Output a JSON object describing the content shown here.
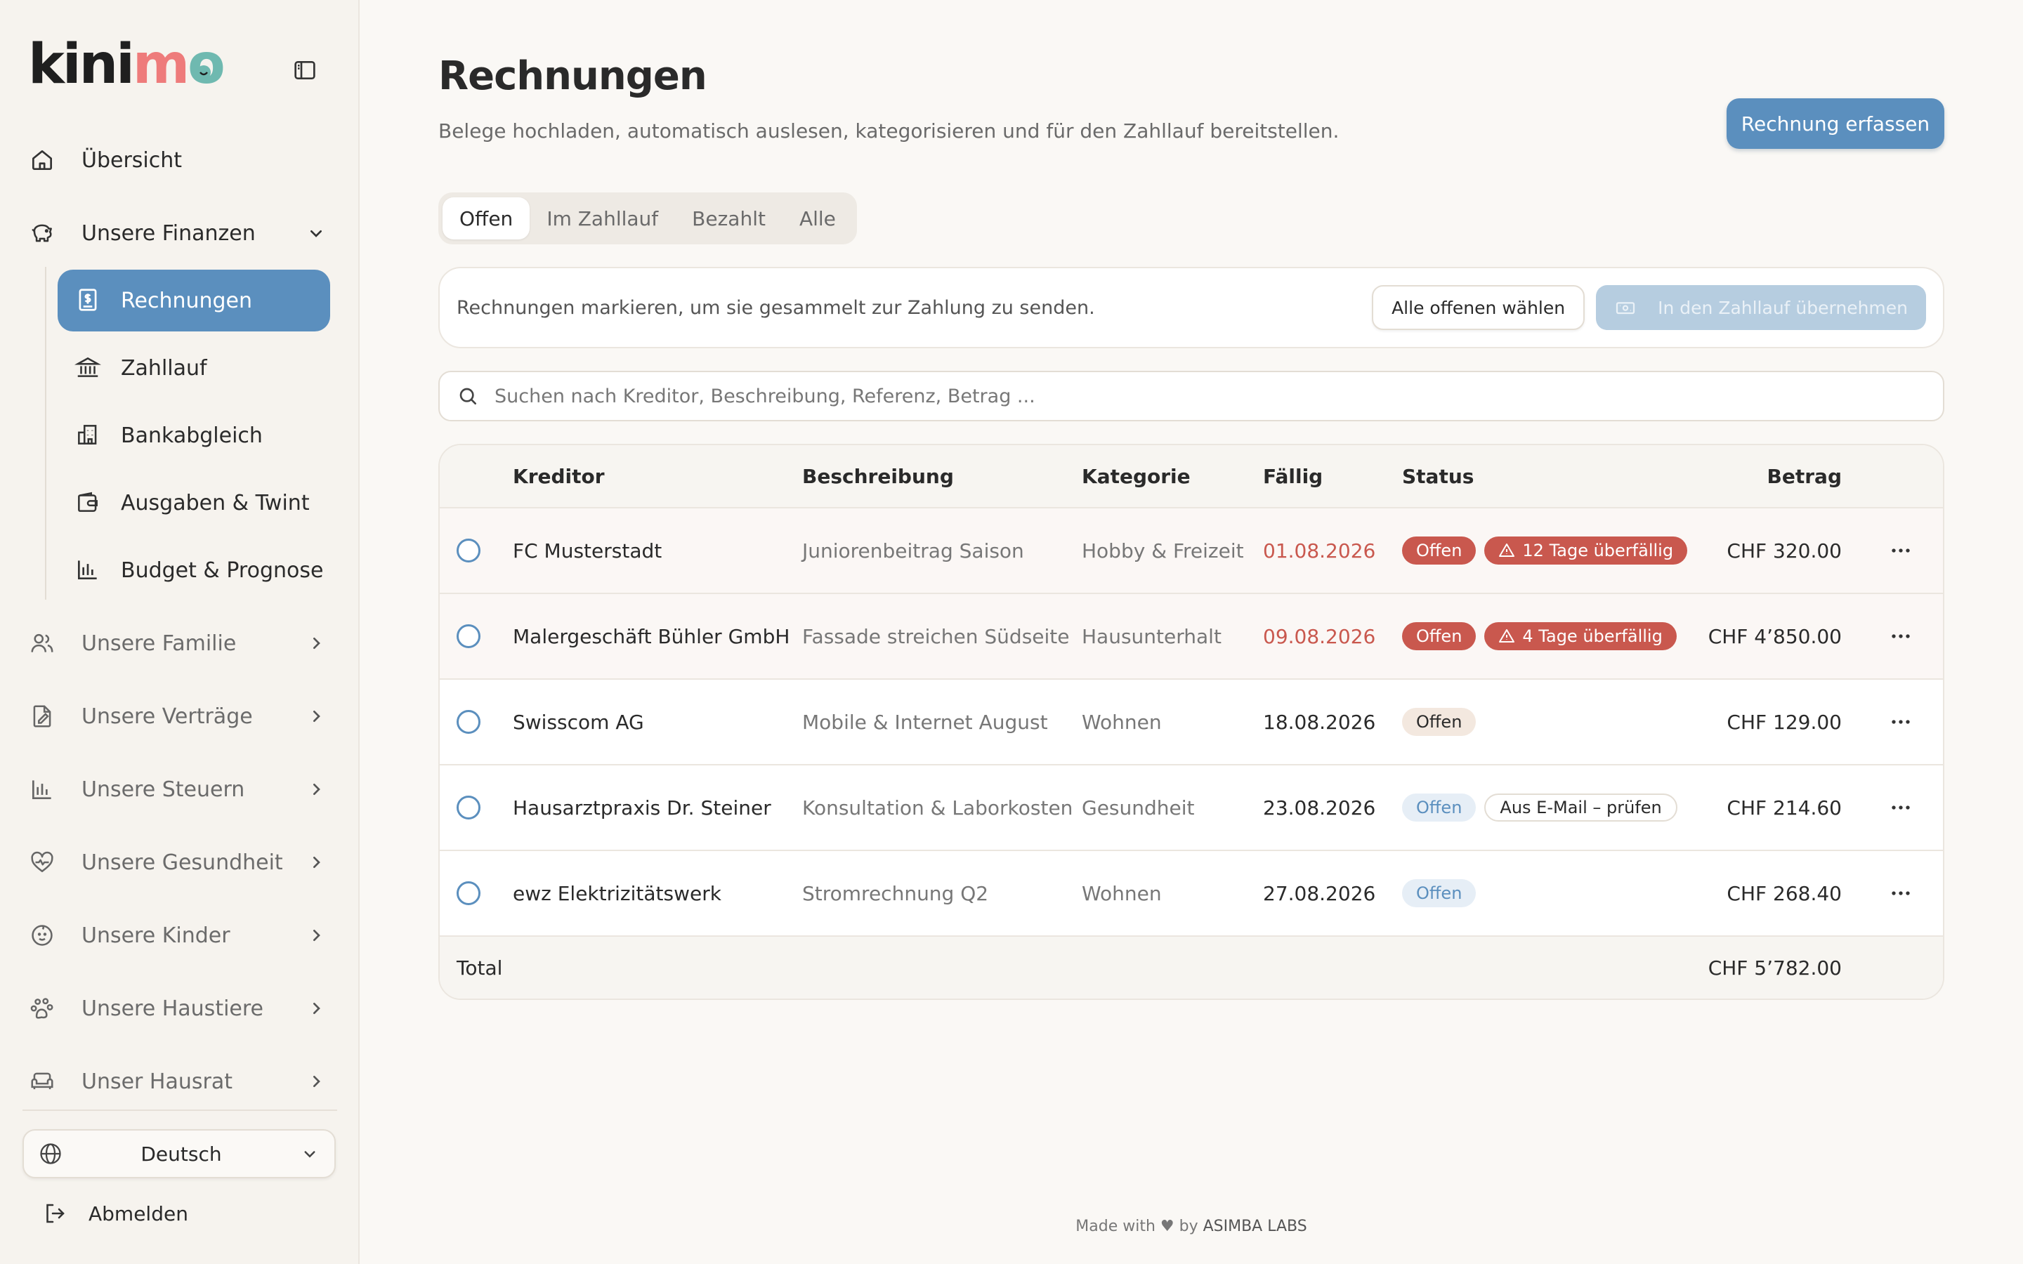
{
  "app": {
    "logo_text": "kinimo"
  },
  "sidebar": {
    "overview": "Übersicht",
    "finances": "Unsere Finanzen",
    "sub_items": [
      {
        "label": "Rechnungen",
        "icon": "invoice-icon",
        "active": true
      },
      {
        "label": "Zahllauf",
        "icon": "bank-icon",
        "active": false
      },
      {
        "label": "Bankabgleich",
        "icon": "building-icon",
        "active": false
      },
      {
        "label": "Ausgaben & Twint",
        "icon": "wallet-icon",
        "active": false
      },
      {
        "label": "Budget & Prognose",
        "icon": "chart-bars-icon",
        "active": false
      }
    ],
    "sections": [
      {
        "label": "Unsere Familie",
        "icon": "users-icon"
      },
      {
        "label": "Unsere Verträge",
        "icon": "contract-icon"
      },
      {
        "label": "Unsere Steuern",
        "icon": "chart-bars-icon"
      },
      {
        "label": "Unsere Gesundheit",
        "icon": "heart-pulse-icon"
      },
      {
        "label": "Unsere Kinder",
        "icon": "baby-icon"
      },
      {
        "label": "Unsere Haustiere",
        "icon": "paw-icon"
      },
      {
        "label": "Unser Hausrat",
        "icon": "sofa-icon"
      }
    ],
    "language": "Deutsch",
    "logout": "Abmelden"
  },
  "main": {
    "title": "Rechnungen",
    "subtitle": "Belege hochladen, automatisch auslesen, kategorisieren und für den Zahllauf bereitstellen.",
    "primary_button": "Rechnung erfassen",
    "tabs": [
      "Offen",
      "Im Zahllauf",
      "Bezahlt",
      "Alle"
    ],
    "active_tab": "Offen",
    "info_text": "Rechnungen markieren, um sie gesammelt zur Zahlung zu senden.",
    "select_all_button": "Alle offenen wählen",
    "transfer_button": "In den Zahllauf übernehmen",
    "search_placeholder": "Suchen nach Kreditor, Beschreibung, Referenz, Betrag ..."
  },
  "table": {
    "headers": {
      "kreditor": "Kreditor",
      "beschreibung": "Beschreibung",
      "kategorie": "Kategorie",
      "faellig": "Fällig",
      "status": "Status",
      "betrag": "Betrag"
    },
    "rows": [
      {
        "kreditor": "FC Musterstadt",
        "beschreibung": "Juniorenbeitrag Saison",
        "kategorie": "Hobby & Freizeit",
        "faellig": "01.08.2026",
        "overdue": true,
        "status": "Offen",
        "status_style": "red",
        "extra": "12 Tage überfällig",
        "extra_style": "red",
        "betrag": "CHF 320.00"
      },
      {
        "kreditor": "Malergeschäft Bühler GmbH",
        "beschreibung": "Fassade streichen Südseite",
        "kategorie": "Hausunterhalt",
        "faellig": "09.08.2026",
        "overdue": true,
        "status": "Offen",
        "status_style": "red",
        "extra": "4 Tage überfällig",
        "extra_style": "red",
        "betrag": "CHF 4’850.00"
      },
      {
        "kreditor": "Swisscom AG",
        "beschreibung": "Mobile & Internet August",
        "kategorie": "Wohnen",
        "faellig": "18.08.2026",
        "overdue": false,
        "status": "Offen",
        "status_style": "beige",
        "extra": "",
        "extra_style": "",
        "betrag": "CHF 129.00"
      },
      {
        "kreditor": "Hausarztpraxis Dr. Steiner",
        "beschreibung": "Konsultation & Laborkosten",
        "kategorie": "Gesundheit",
        "faellig": "23.08.2026",
        "overdue": false,
        "status": "Offen",
        "status_style": "blue",
        "extra": "Aus E-Mail – prüfen",
        "extra_style": "outline",
        "betrag": "CHF 214.60"
      },
      {
        "kreditor": "ewz Elektrizitätswerk",
        "beschreibung": "Stromrechnung Q2",
        "kategorie": "Wohnen",
        "faellig": "27.08.2026",
        "overdue": false,
        "status": "Offen",
        "status_style": "blue",
        "extra": "",
        "extra_style": "",
        "betrag": "CHF 268.40"
      }
    ],
    "total_label": "Total",
    "total_amount": "CHF 5’782.00"
  },
  "footer": {
    "prefix": "Made with ♥ by",
    "brand": "ASIMBA LABS"
  },
  "colors": {
    "accent": "#5b8fbe",
    "danger": "#c9584e",
    "background": "#faf8f5",
    "sidebar": "#f6f3ee"
  }
}
